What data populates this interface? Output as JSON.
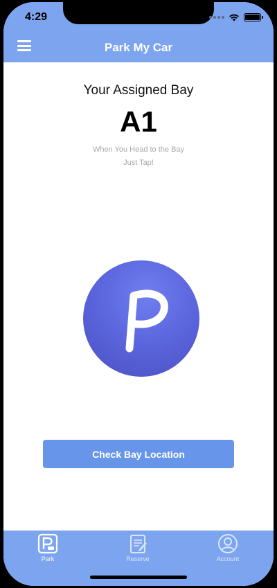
{
  "status_bar": {
    "time": "4:29",
    "icons": [
      "signal-icon",
      "wifi-icon",
      "battery-icon"
    ]
  },
  "nav": {
    "menu_icon": "hamburger-menu-icon",
    "title": "Park My Car"
  },
  "main": {
    "heading": "Your Assigned Bay",
    "bay": "A1",
    "hint_line1": "When You Head to the Bay",
    "hint_line2": "Just Tap!",
    "park_button_letter": "P",
    "check_button_label": "Check Bay Location"
  },
  "tabs": [
    {
      "label": "Park",
      "icon": "parking-icon",
      "active": true
    },
    {
      "label": "Reserve",
      "icon": "clipboard-icon",
      "active": false
    },
    {
      "label": "Account",
      "icon": "user-icon",
      "active": false
    }
  ],
  "colors": {
    "bar_blue": "#7da4ef",
    "button_blue": "#6795ea",
    "circle_purple": "#5c66de"
  }
}
